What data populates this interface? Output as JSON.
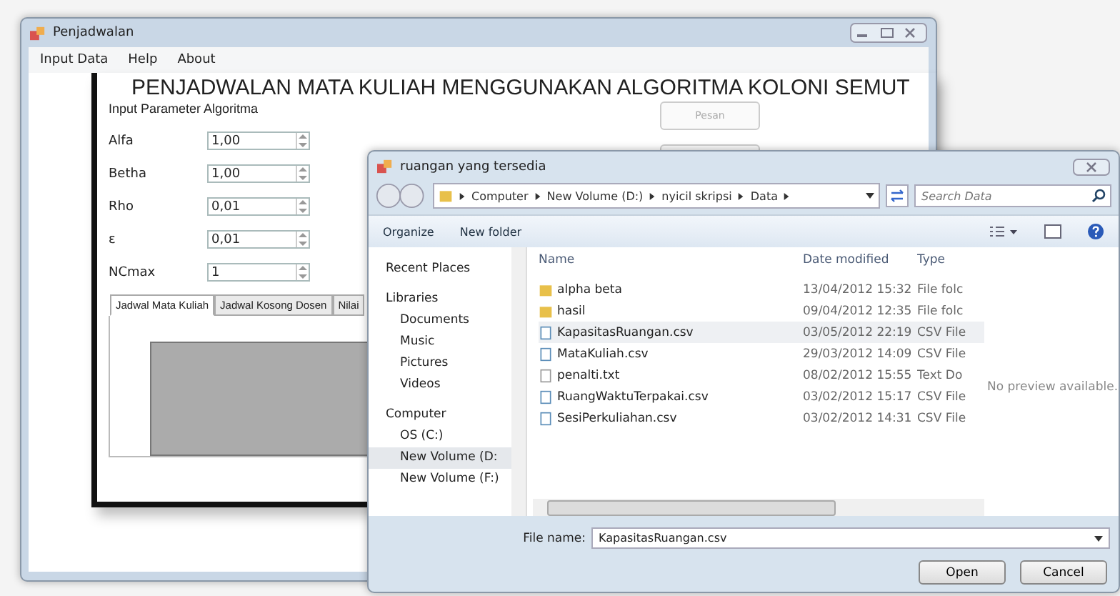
{
  "main_window": {
    "title": "Penjadwalan",
    "menu": [
      "Input Data",
      "Help",
      "About"
    ],
    "heading": "PENJADWALAN MATA KULIAH MENGGUNAKAN ALGORITMA KOLONI SEMUT",
    "section_label": "Input Parameter Algoritma",
    "params": [
      {
        "label": "Alfa",
        "value": "1,00"
      },
      {
        "label": "Betha",
        "value": "1,00"
      },
      {
        "label": "Rho",
        "value": "0,01"
      },
      {
        "label": "ε",
        "value": "0,01"
      },
      {
        "label": "NCmax",
        "value": "1"
      }
    ],
    "button": "Pesan",
    "tabs": [
      {
        "label": "Jadwal Mata Kuliah",
        "selected": true
      },
      {
        "label": "Jadwal Kosong Dosen",
        "selected": false
      },
      {
        "label": "Nilai",
        "selected": false
      }
    ]
  },
  "dialog": {
    "title": "ruangan yang tersedia",
    "breadcrumb": [
      "Computer",
      "New Volume (D:)",
      "nyicil skripsi",
      "Data"
    ],
    "search": {
      "placeholder": "Search Data"
    },
    "toolbar": [
      "Organize",
      "New folder"
    ],
    "nav": [
      {
        "label": "Recent Places",
        "selected": false
      },
      {
        "label": "Libraries",
        "selected": false,
        "children": [
          {
            "label": "Documents",
            "selected": false
          },
          {
            "label": "Music",
            "selected": false
          },
          {
            "label": "Pictures",
            "selected": false
          },
          {
            "label": "Videos",
            "selected": false
          }
        ]
      },
      {
        "label": "Computer",
        "selected": false,
        "children": [
          {
            "label": "OS (C:)",
            "selected": false
          },
          {
            "label": "New Volume (D:",
            "selected": true
          },
          {
            "label": "New Volume (F:)",
            "selected": false
          }
        ]
      }
    ],
    "columns": [
      "Name",
      "Date modified",
      "Type"
    ],
    "files": [
      {
        "name": "alpha beta",
        "date": "13/04/2012 15:32",
        "type": "File folc",
        "kind": "folder",
        "selected": false
      },
      {
        "name": "hasil",
        "date": "09/04/2012 12:35",
        "type": "File folc",
        "kind": "folder",
        "selected": false
      },
      {
        "name": "KapasitasRuangan.csv",
        "date": "03/05/2012 22:19",
        "type": "CSV File",
        "kind": "csv",
        "selected": true
      },
      {
        "name": "MataKuliah.csv",
        "date": "29/03/2012 14:09",
        "type": "CSV File",
        "kind": "csv",
        "selected": false
      },
      {
        "name": "penalti.txt",
        "date": "08/02/2012 15:55",
        "type": "Text Do",
        "kind": "txt",
        "selected": false
      },
      {
        "name": "RuangWaktuTerpakai.csv",
        "date": "03/02/2012 15:17",
        "type": "CSV File",
        "kind": "csv",
        "selected": false
      },
      {
        "name": "SesiPerkuliahan.csv",
        "date": "03/02/2012 14:31",
        "type": "CSV File",
        "kind": "csv",
        "selected": false
      }
    ],
    "preview_text": "No preview available.",
    "file_name_label": "File name:",
    "file_name": "KapasitasRuangan.csv",
    "actions": [
      "Open",
      "Cancel"
    ]
  }
}
